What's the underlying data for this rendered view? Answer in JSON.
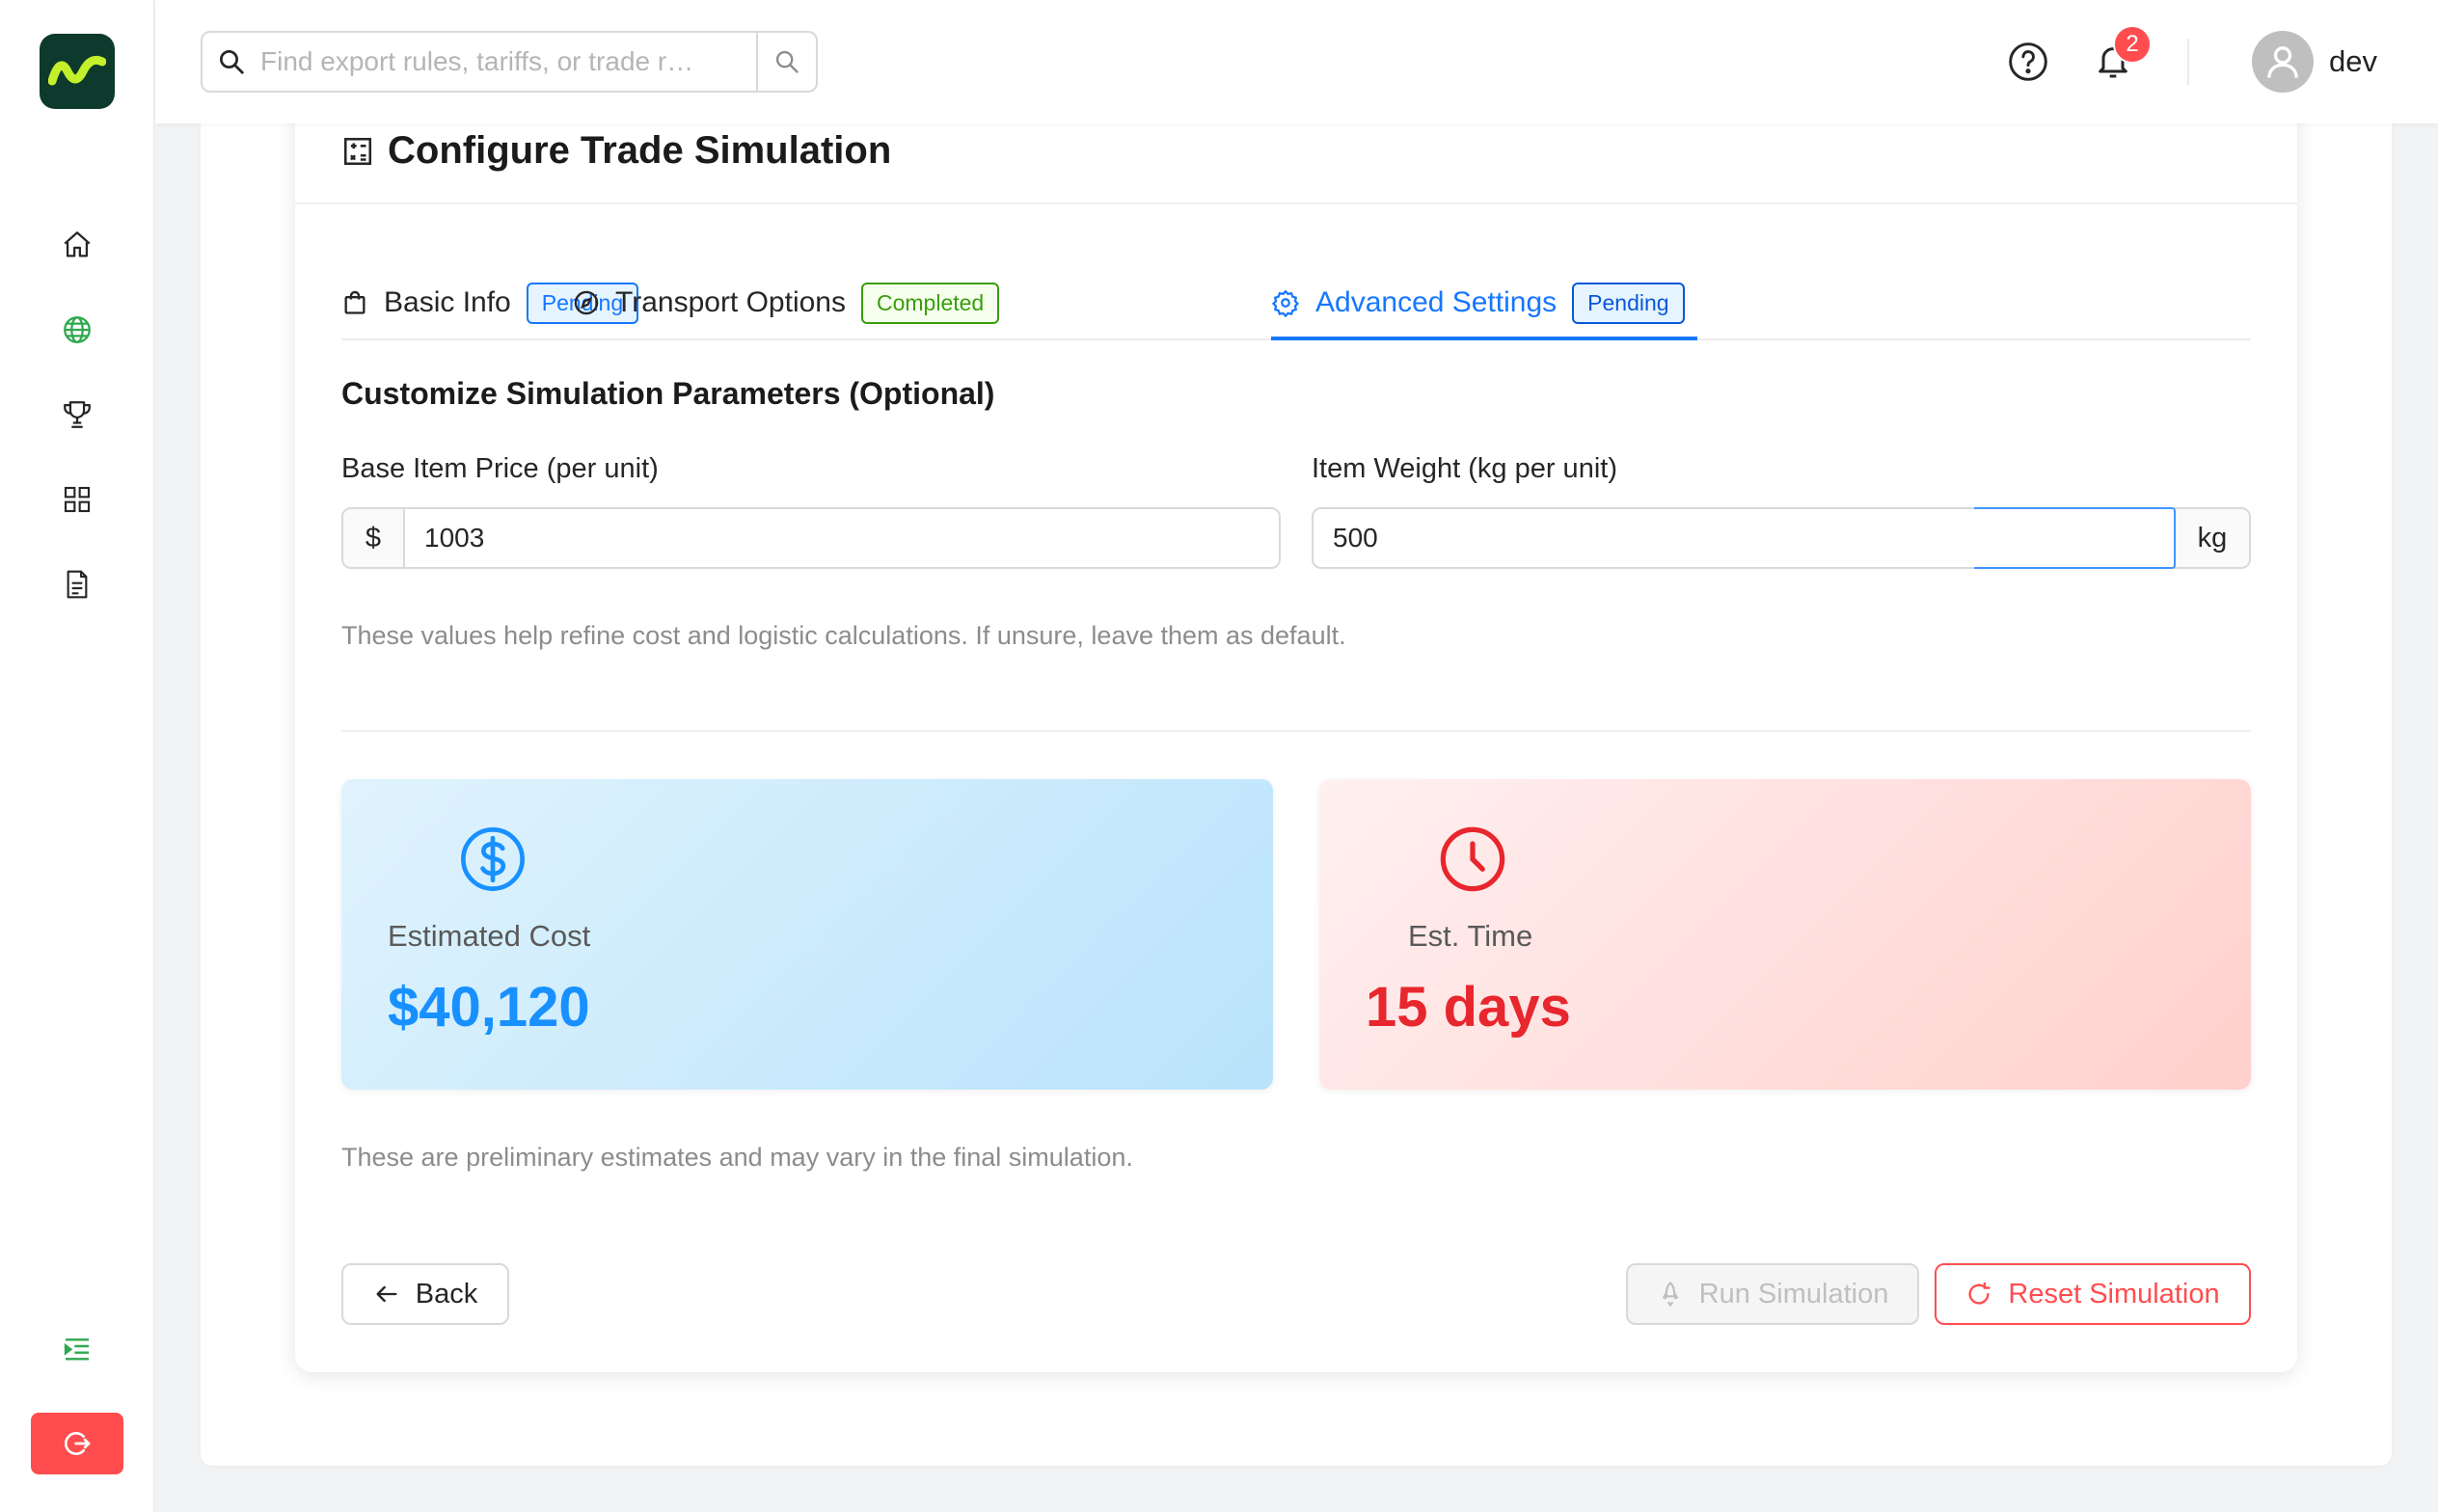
{
  "sidebar": {
    "logo_icon": "wave-logo-icon",
    "items": [
      {
        "name": "home-icon",
        "active": false
      },
      {
        "name": "globe-icon",
        "active": true
      },
      {
        "name": "trophy-icon",
        "active": false
      },
      {
        "name": "grid-icon",
        "active": false
      },
      {
        "name": "document-icon",
        "active": false
      }
    ],
    "collapse_icon": "indent-icon",
    "logout_icon": "logout-icon"
  },
  "header": {
    "search_placeholder": "Find export rules, tariffs, or trade r…",
    "notification_count": "2",
    "username": "dev"
  },
  "card": {
    "title": "Configure Trade Simulation",
    "tabs": [
      {
        "label": "Basic Info",
        "status": "Pending",
        "icon": "shopping-bag-icon"
      },
      {
        "label": "Transport Options",
        "status": "Completed",
        "icon": "compass-icon"
      },
      {
        "label": "Advanced Settings",
        "status": "Pending",
        "icon": "gear-icon",
        "active": true
      }
    ],
    "section_title": "Customize Simulation Parameters (Optional)",
    "price": {
      "label": "Base Item Price (per unit)",
      "prefix": "$",
      "value": "1003"
    },
    "weight": {
      "label": "Item Weight (kg per unit)",
      "suffix": "kg",
      "value": "500"
    },
    "help_text": "These values help refine cost and logistic calculations. If unsure, leave them as default.",
    "estimates": {
      "cost_label": "Estimated Cost",
      "cost_value": "$40,120",
      "time_label": "Est. Time",
      "time_value": "15 days"
    },
    "note": "These are preliminary estimates and may vary in the final simulation.",
    "buttons": {
      "back": "Back",
      "run": "Run Simulation",
      "reset": "Reset Simulation"
    }
  },
  "colors": {
    "primary": "#1677ff",
    "danger": "#ff4d4f",
    "cost_accent": "#1890ff",
    "time_accent": "#e8262d",
    "logo_bg": "#0d3a2c",
    "logo_wave": "#c4f02b",
    "active_nav": "#2fa84f"
  }
}
